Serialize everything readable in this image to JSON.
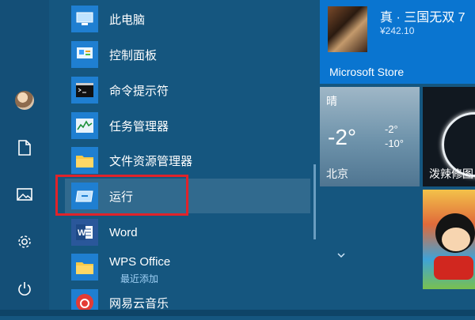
{
  "apps": [
    {
      "id": "this-pc",
      "label": "此电脑"
    },
    {
      "id": "control-panel",
      "label": "控制面板"
    },
    {
      "id": "cmd",
      "label": "命令提示符"
    },
    {
      "id": "task-manager",
      "label": "任务管理器"
    },
    {
      "id": "file-explorer",
      "label": "文件资源管理器"
    },
    {
      "id": "run",
      "label": "运行"
    },
    {
      "id": "word",
      "label": "Word"
    },
    {
      "id": "wps-office",
      "label": "WPS Office",
      "sub": "最近添加"
    },
    {
      "id": "netease-music",
      "label": "网易云音乐"
    }
  ],
  "tiles": {
    "store": {
      "title": "真 · 三国无双 7",
      "price": "¥242.10",
      "name": "Microsoft Store"
    },
    "weather": {
      "condition": "晴",
      "temp": "-2°",
      "high": "-2°",
      "low": "-10°",
      "city": "北京"
    },
    "hot": {
      "label": "泼辣修图"
    }
  },
  "colors": {
    "highlight_border": "#e0232a",
    "tile_blue": "#0a75d0"
  }
}
